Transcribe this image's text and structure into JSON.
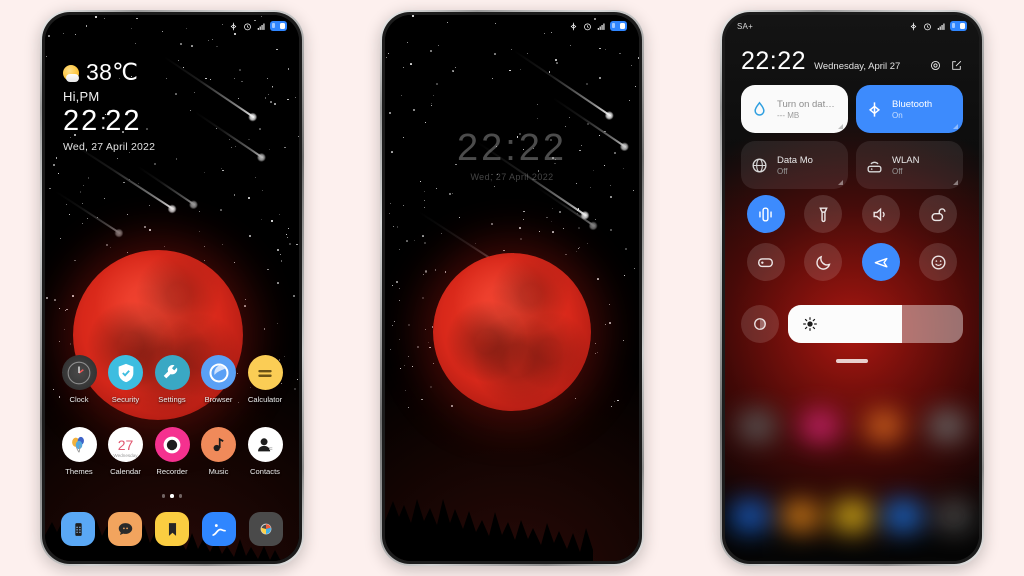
{
  "background_color": "#fdf0ee",
  "accent_blue": "#3d8bfd",
  "moon_color": "#d8281a",
  "phone1": {
    "name": "home-screen",
    "statusbar": {
      "icons": [
        "bluetooth-icon",
        "alarm-icon",
        "signal-icon",
        "battery-icon"
      ]
    },
    "widget": {
      "temperature": "38℃",
      "greeting": "Hi,PM",
      "hours": "22",
      "colon": ":",
      "minutes": "22",
      "date": "Wed, 27 April 2022"
    },
    "apps_row1": [
      {
        "label": "Clock",
        "icon": "clock-icon"
      },
      {
        "label": "Security",
        "icon": "shield-icon"
      },
      {
        "label": "Settings",
        "icon": "wrench-icon"
      },
      {
        "label": "Browser",
        "icon": "browser-icon"
      },
      {
        "label": "Calculator",
        "icon": "calculator-icon"
      }
    ],
    "apps_row2": [
      {
        "label": "Themes",
        "icon": "balloons-icon"
      },
      {
        "label": "Calendar",
        "icon": "calendar-icon",
        "day": "27",
        "weekday": "Wednesday"
      },
      {
        "label": "Recorder",
        "icon": "recorder-icon"
      },
      {
        "label": "Music",
        "icon": "music-note-icon"
      },
      {
        "label": "Contacts",
        "icon": "contact-person-icon"
      }
    ],
    "page_dots": {
      "count": 3,
      "active_index": 1
    },
    "dock": [
      {
        "name": "phone-app",
        "icon": "dialer-icon"
      },
      {
        "name": "messages-app",
        "icon": "message-icon"
      },
      {
        "name": "notes-app",
        "icon": "bookmark-icon"
      },
      {
        "name": "gallery-app",
        "icon": "gallery-icon"
      },
      {
        "name": "camera-app",
        "icon": "camera-icon"
      }
    ]
  },
  "phone2": {
    "name": "lock-screen",
    "statusbar": {
      "icons": [
        "bluetooth-icon",
        "alarm-icon",
        "signal-icon",
        "battery-icon"
      ]
    },
    "clock": {
      "hours": "22",
      "colon": ":",
      "minutes": "22",
      "date": "Wed, 27 April 2022"
    }
  },
  "phone3": {
    "name": "control-center",
    "statusbar": {
      "carrier": "SA+",
      "icons": [
        "bluetooth-icon",
        "alarm-icon",
        "signal-icon",
        "battery-icon"
      ]
    },
    "header": {
      "time": "22:22",
      "date": "Wednesday, April 27",
      "settings_icon": "gear-icon",
      "edit_icon": "edit-icon"
    },
    "tiles": [
      {
        "title": "Turn on data plan",
        "subtitle": "--- MB",
        "state": "light",
        "icon": "water-drop-icon"
      },
      {
        "title": "Bluetooth",
        "subtitle": "On",
        "state": "blue",
        "icon": "bluetooth-icon"
      },
      {
        "title": "Data       Mo",
        "subtitle": "Off",
        "state": "dark",
        "icon": "globe-icon"
      },
      {
        "title": "WLAN",
        "subtitle": "Off",
        "state": "dark",
        "icon": "wifi-router-icon"
      }
    ],
    "toggles": [
      {
        "name": "vibrate-toggle",
        "icon": "vibrate-icon",
        "active": true
      },
      {
        "name": "flashlight-toggle",
        "icon": "flashlight-icon",
        "active": false
      },
      {
        "name": "sound-toggle",
        "icon": "speaker-icon",
        "active": false
      },
      {
        "name": "lock-toggle",
        "icon": "lock-icon",
        "active": false
      },
      {
        "name": "cast-toggle",
        "icon": "cast-icon",
        "active": false
      },
      {
        "name": "darkmode-toggle",
        "icon": "moon-icon",
        "active": false
      },
      {
        "name": "airplane-toggle",
        "icon": "airplane-icon",
        "active": true
      },
      {
        "name": "emoji-toggle",
        "icon": "smiley-icon",
        "active": false
      }
    ],
    "brightness": {
      "icon": "brightness-icon",
      "level_percent": 65,
      "aux_icon": "auto-brightness-icon"
    }
  }
}
